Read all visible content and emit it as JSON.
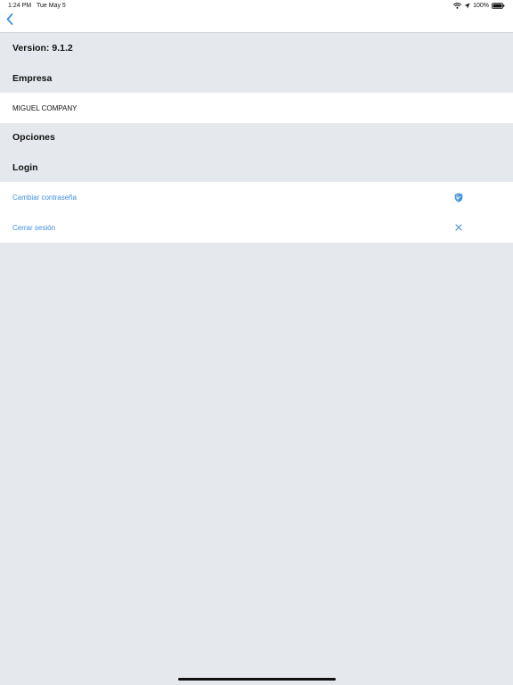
{
  "status_bar": {
    "time": "1:24 PM",
    "date": "Tue May 5",
    "battery": "100%",
    "icons": [
      "wifi-icon",
      "location-arrow-icon",
      "battery-icon"
    ]
  },
  "nav": {
    "back_icon": "chevron-left-icon"
  },
  "sections": {
    "version": {
      "label": "Version:  9.1.2"
    },
    "empresa": {
      "label": "Empresa",
      "value": "MIGUEL COMPANY"
    },
    "opciones": {
      "label": "Opciones"
    },
    "login": {
      "label": "Login",
      "items": [
        {
          "label": "Cambiar contraseña",
          "icon": "shield-icon"
        },
        {
          "label": "Cerrar sesión",
          "icon": "close-icon"
        }
      ]
    }
  },
  "colors": {
    "accent": "#3f8fdd",
    "background": "#e5e8ed",
    "row_background": "#ffffff",
    "text": "#111111"
  }
}
